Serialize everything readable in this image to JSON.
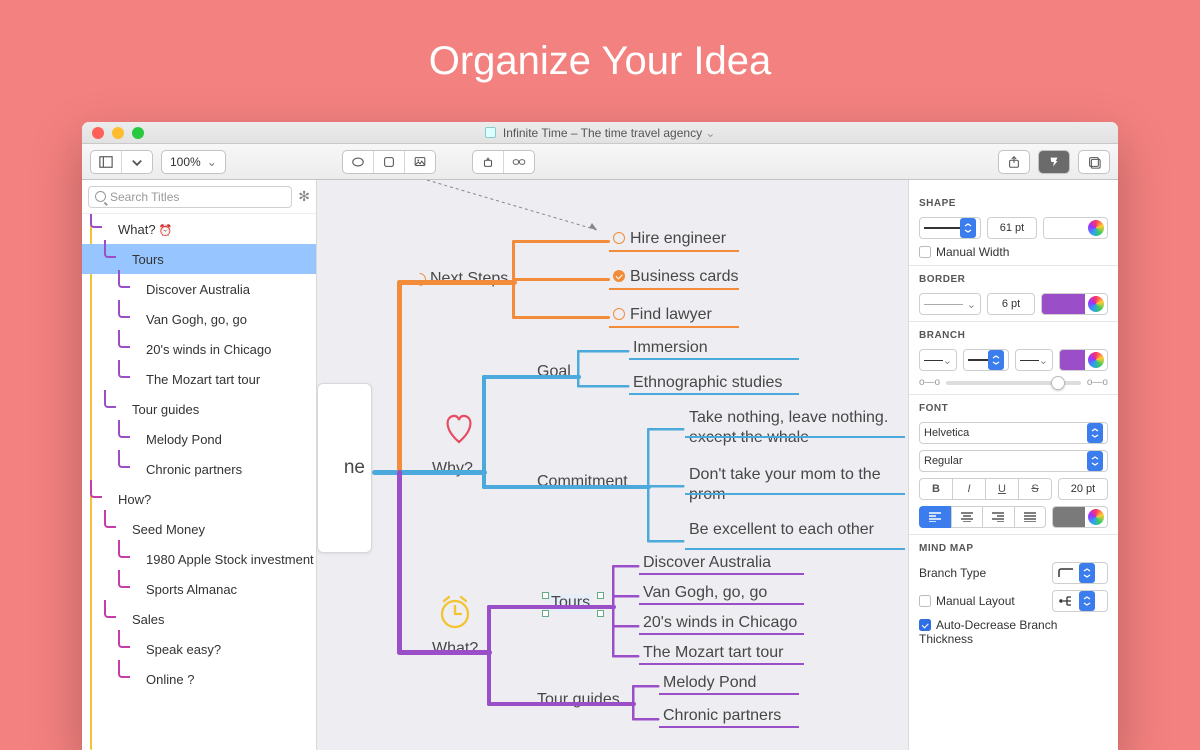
{
  "hero": "Organize Your Idea",
  "window": {
    "title": "Infinite Time – The time travel agency"
  },
  "toolbar": {
    "zoom": "100%"
  },
  "search": {
    "placeholder": "Search Titles"
  },
  "colors": {
    "orange": "#F28C3B",
    "blue": "#4BA9DC",
    "purple": "#9A4FC9",
    "magenta": "#C63CA8",
    "yellow": "#F2C431",
    "red": "#E74C62"
  },
  "outline": [
    {
      "label": "What?",
      "depth": 1,
      "color": "purple",
      "badge": "clock"
    },
    {
      "label": "Tours",
      "depth": 2,
      "color": "purple",
      "selected": true
    },
    {
      "label": "Discover Australia",
      "depth": 3,
      "color": "purple"
    },
    {
      "label": "Van Gogh, go, go",
      "depth": 3,
      "color": "purple"
    },
    {
      "label": "20's winds in Chicago",
      "depth": 3,
      "color": "purple"
    },
    {
      "label": "The Mozart tart tour",
      "depth": 3,
      "color": "purple"
    },
    {
      "label": "Tour guides",
      "depth": 2,
      "color": "purple"
    },
    {
      "label": "Melody Pond",
      "depth": 3,
      "color": "purple"
    },
    {
      "label": "Chronic partners",
      "depth": 3,
      "color": "purple"
    },
    {
      "label": "How?",
      "depth": 1,
      "color": "magenta",
      "badge": "tag"
    },
    {
      "label": "Seed Money",
      "depth": 2,
      "color": "magenta"
    },
    {
      "label": "1980 Apple Stock investment",
      "depth": 3,
      "color": "magenta"
    },
    {
      "label": "Sports Almanac",
      "depth": 3,
      "color": "magenta"
    },
    {
      "label": "Sales",
      "depth": 2,
      "color": "magenta"
    },
    {
      "label": "Speak easy?",
      "depth": 3,
      "color": "magenta"
    },
    {
      "label": "Online ?",
      "depth": 3,
      "color": "magenta"
    }
  ],
  "map": {
    "root_fragment": "ne",
    "next_steps": {
      "label": "Next Steps",
      "items": [
        {
          "label": "Hire engineer",
          "checked": false
        },
        {
          "label": "Business cards",
          "checked": true
        },
        {
          "label": "Find lawyer",
          "checked": false
        }
      ]
    },
    "why": {
      "label": "Why?",
      "goal": {
        "label": "Goal",
        "items": [
          "Immersion",
          "Ethnographic studies"
        ]
      },
      "commitment": {
        "label": "Commitment",
        "items": [
          "Take nothing, leave nothing. except the whale",
          "Don't take your mom to the prom",
          "Be excellent to each other"
        ]
      }
    },
    "what": {
      "label": "What?",
      "tours": {
        "label": "Tours",
        "items": [
          "Discover Australia",
          "Van Gogh, go, go",
          "20's winds in Chicago",
          "The Mozart tart tour"
        ]
      },
      "guides": {
        "label": "Tour guides",
        "items": [
          "Melody Pond",
          "Chronic partners"
        ]
      }
    }
  },
  "inspector": {
    "shape": {
      "title": "SHAPE",
      "width_value": "61 pt",
      "manual_width_label": "Manual Width",
      "manual_width": false
    },
    "border": {
      "title": "BORDER",
      "width_value": "6 pt",
      "color": "#9A4FC9"
    },
    "branch": {
      "title": "BRANCH",
      "color": "#9A4FC9"
    },
    "font": {
      "title": "FONT",
      "family": "Helvetica",
      "weight": "Regular",
      "size": "20 pt",
      "b": "B",
      "i": "I",
      "u": "U",
      "s": "S"
    },
    "mindmap": {
      "title": "MIND MAP",
      "branch_type_label": "Branch Type",
      "manual_layout_label": "Manual Layout",
      "manual_layout": false,
      "auto_thickness_label": "Auto-Decrease Branch Thickness",
      "auto_thickness": true
    }
  }
}
